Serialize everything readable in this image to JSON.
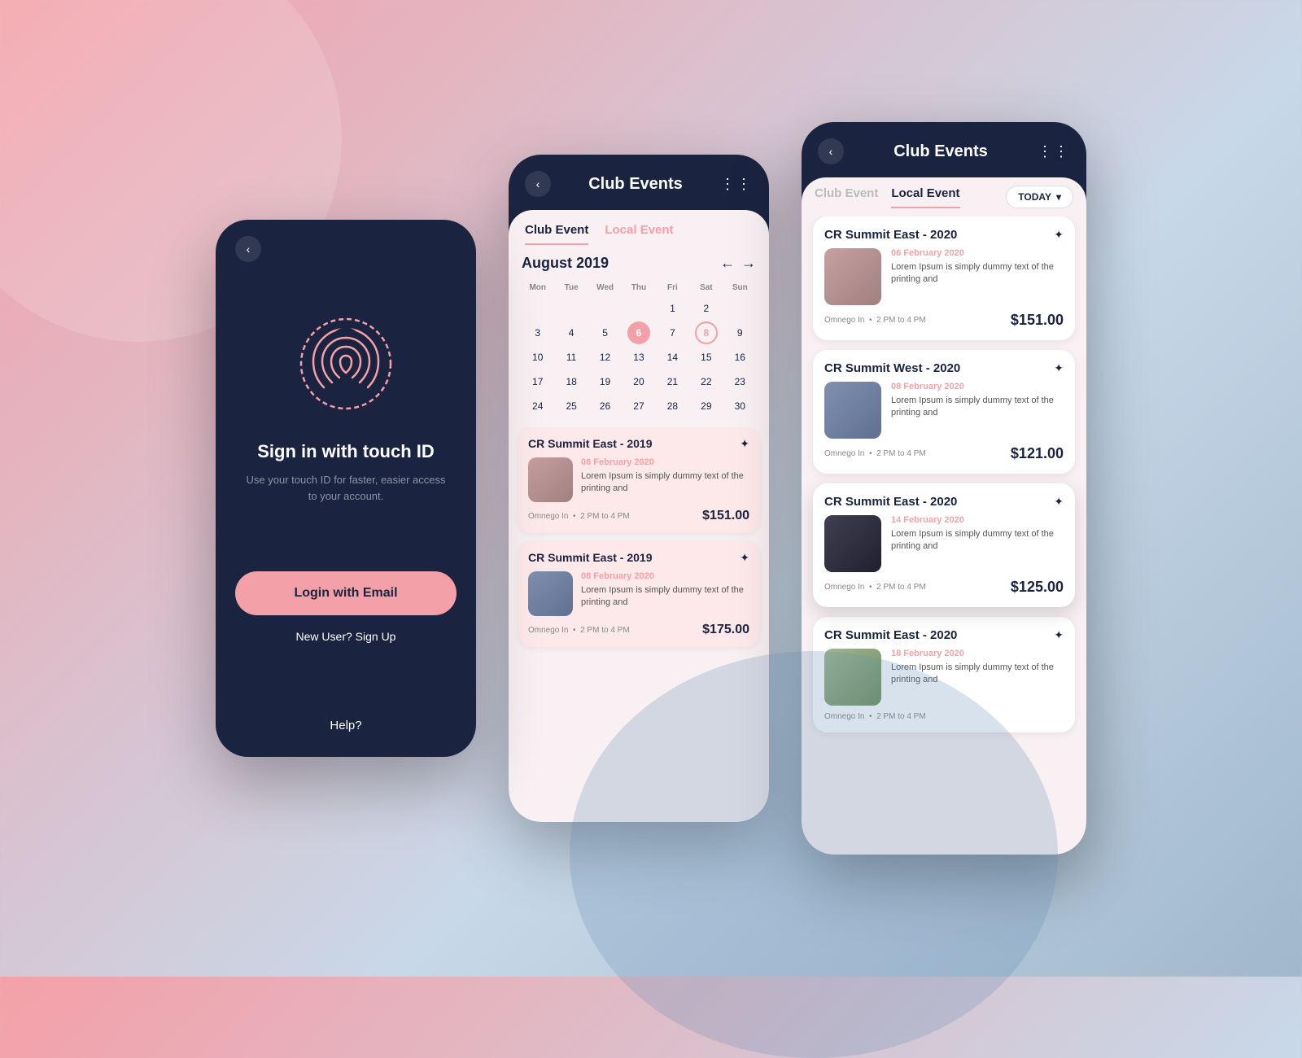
{
  "phone1": {
    "back_label": "‹",
    "sign_in_title": "Sign in with touch ID",
    "sign_in_subtitle": "Use your touch ID for faster, easier\naccess to your account.",
    "login_btn": "Login with Email",
    "new_user": "New User? Sign Up",
    "help": "Help?"
  },
  "phone2": {
    "title": "Club Events",
    "back_label": "‹",
    "dots": "⋮⋮",
    "tab_club": "Club Event",
    "tab_local": "Local Event",
    "month": "August",
    "year": "2019",
    "days": [
      "Mon",
      "Tue",
      "Wed",
      "Thu",
      "Fri",
      "Sat",
      "Sun"
    ],
    "dates": [
      {
        "d": "",
        "empty": true
      },
      {
        "d": "",
        "empty": true
      },
      {
        "d": "",
        "empty": true
      },
      {
        "d": "",
        "empty": true
      },
      {
        "d": "1",
        "empty": false
      },
      {
        "d": "2",
        "empty": false
      },
      {
        "d": "",
        "empty": true
      },
      {
        "d": "3"
      },
      {
        "d": "4"
      },
      {
        "d": "5"
      },
      {
        "d": "6",
        "highlight": "pink"
      },
      {
        "d": "7"
      },
      {
        "d": "8",
        "highlight": "outline"
      },
      {
        "d": "9"
      },
      {
        "d": "10"
      },
      {
        "d": "11"
      },
      {
        "d": "12"
      },
      {
        "d": "13"
      },
      {
        "d": "14"
      },
      {
        "d": "15"
      },
      {
        "d": "16"
      },
      {
        "d": "17"
      },
      {
        "d": "18"
      },
      {
        "d": "19"
      },
      {
        "d": "20"
      },
      {
        "d": "21"
      },
      {
        "d": "22"
      },
      {
        "d": "23"
      },
      {
        "d": "24"
      },
      {
        "d": "25"
      },
      {
        "d": "26"
      },
      {
        "d": "27"
      },
      {
        "d": "28"
      },
      {
        "d": "29"
      },
      {
        "d": "30"
      }
    ],
    "events": [
      {
        "title": "CR Summit East - 2019",
        "date": "06 February 2020",
        "desc": "Lorem Ipsum is simply dummy text of the printing and",
        "venue": "Omnego In",
        "time": "2 PM to 4 PM",
        "price": "$151.00",
        "img": "warm"
      },
      {
        "title": "CR Summit East - 2019",
        "date": "08 February 2020",
        "desc": "Lorem Ipsum is simply dummy text of the printing and",
        "venue": "Omnego In",
        "time": "2 PM to 4 PM",
        "price": "$175.00",
        "img": "cool"
      }
    ]
  },
  "phone3": {
    "title": "Club Events",
    "back_label": "‹",
    "dots": "⋮⋮",
    "tab_club": "Club Event",
    "tab_local": "Local Event",
    "today_btn": "TODAY",
    "events": [
      {
        "title": "CR Summit East - 2020",
        "date": "06 February 2020",
        "desc": "Lorem Ipsum is simply dummy text of the printing and",
        "venue": "Omnego In",
        "time": "2 PM to 4 PM",
        "price": "$151.00",
        "img": "warm"
      },
      {
        "title": "CR Summit West - 2020",
        "date": "08 February 2020",
        "desc": "Lorem Ipsum is simply dummy text of the printing and",
        "venue": "Omnego In",
        "time": "2 PM to 4 PM",
        "price": "$121.00",
        "img": "cool"
      },
      {
        "title": "CR Summit East - 2020",
        "date": "14 February 2020",
        "desc": "Lorem Ipsum is simply dummy text of the printing and",
        "venue": "Omnego In",
        "time": "2 PM to 4 PM",
        "price": "$125.00",
        "img": "dark",
        "elevated": true
      },
      {
        "title": "CR Summit East - 2020",
        "date": "18 February 2020",
        "desc": "Lorem Ipsum is simply dummy text of the printing and",
        "venue": "Omnego In",
        "time": "2 PM to 4 PM",
        "price": "",
        "img": "outdoor"
      }
    ]
  }
}
